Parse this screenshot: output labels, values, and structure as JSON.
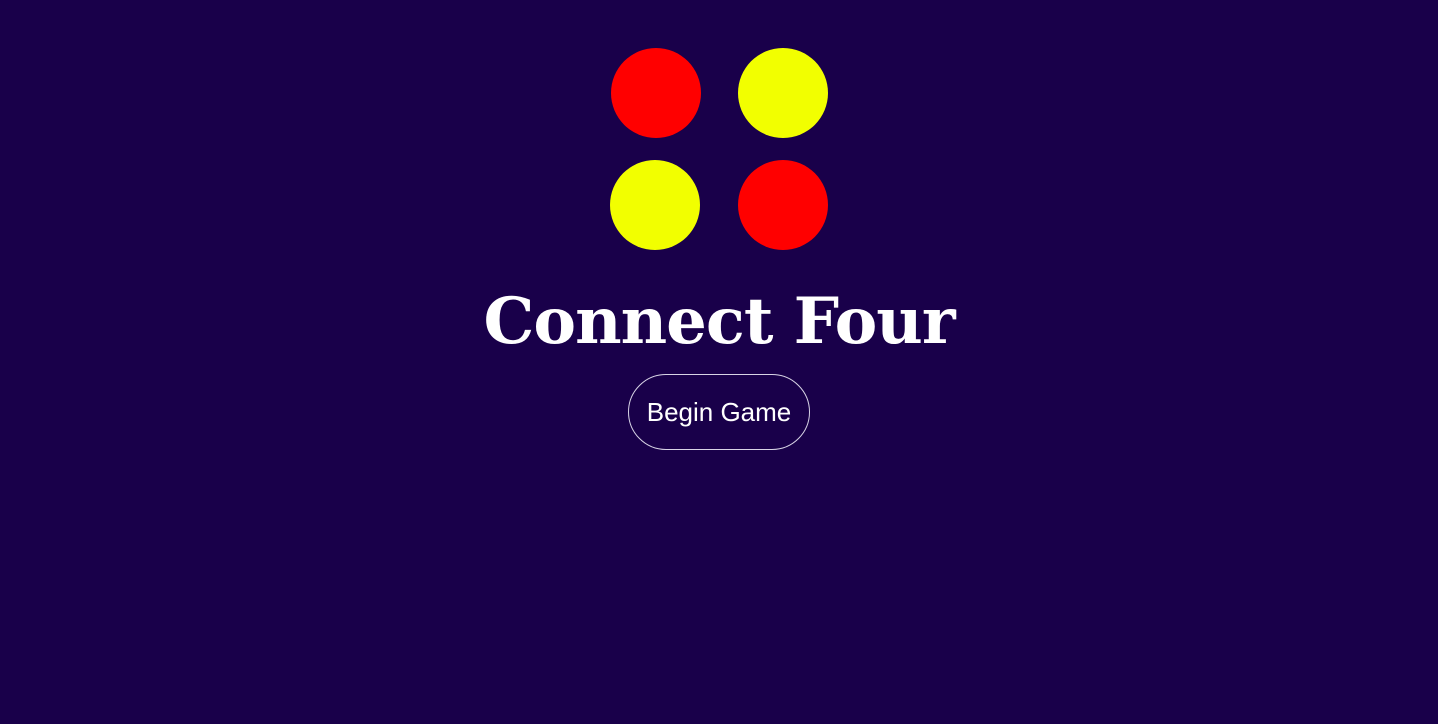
{
  "game": {
    "title": "Connect Four",
    "begin_label": "Begin Game"
  },
  "logo": {
    "discs": [
      {
        "position": "top-left",
        "color": "#ff0000"
      },
      {
        "position": "top-right",
        "color": "#f2ff00"
      },
      {
        "position": "bottom-left",
        "color": "#f2ff00"
      },
      {
        "position": "bottom-right",
        "color": "#ff0000"
      }
    ]
  },
  "colors": {
    "background": "#19004a",
    "text": "#ffffff",
    "red_disc": "#ff0000",
    "yellow_disc": "#f2ff00"
  }
}
